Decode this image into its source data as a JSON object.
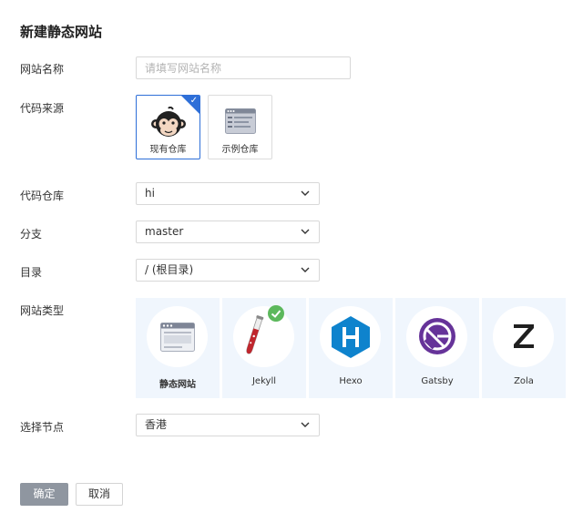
{
  "page": {
    "title": "新建静态网站"
  },
  "labels": {
    "site_name": "网站名称",
    "code_source": "代码来源",
    "code_repo": "代码仓库",
    "branch": "分支",
    "directory": "目录",
    "site_type": "网站类型",
    "node": "选择节点"
  },
  "site_name_input": {
    "value": "",
    "placeholder": "请填写网站名称"
  },
  "source_options": [
    {
      "label": "现有仓库",
      "icon": "monkey-icon",
      "selected": true
    },
    {
      "label": "示例仓库",
      "icon": "template-icon",
      "selected": false
    }
  ],
  "selects": {
    "repo": "hi",
    "branch": "master",
    "directory": "/ (根目录)",
    "node": "香港"
  },
  "site_types": [
    {
      "name": "静态网站",
      "icon": "browser-window-icon",
      "selected": false
    },
    {
      "name": "Jekyll",
      "icon": "jekyll-test-tube-icon",
      "selected": true
    },
    {
      "name": "Hexo",
      "icon": "hexo-logo-icon",
      "selected": false
    },
    {
      "name": "Gatsby",
      "icon": "gatsby-logo-icon",
      "selected": false
    },
    {
      "name": "Zola",
      "icon": "zola-logo-icon",
      "selected": false
    }
  ],
  "buttons": {
    "ok": "确定",
    "cancel": "取消"
  },
  "colors": {
    "primary": "#2e6fd8",
    "check": "#5cb85c",
    "hexo": "#0e83cd",
    "gatsby": "#663399",
    "button_disabled": "#8f96a0"
  }
}
